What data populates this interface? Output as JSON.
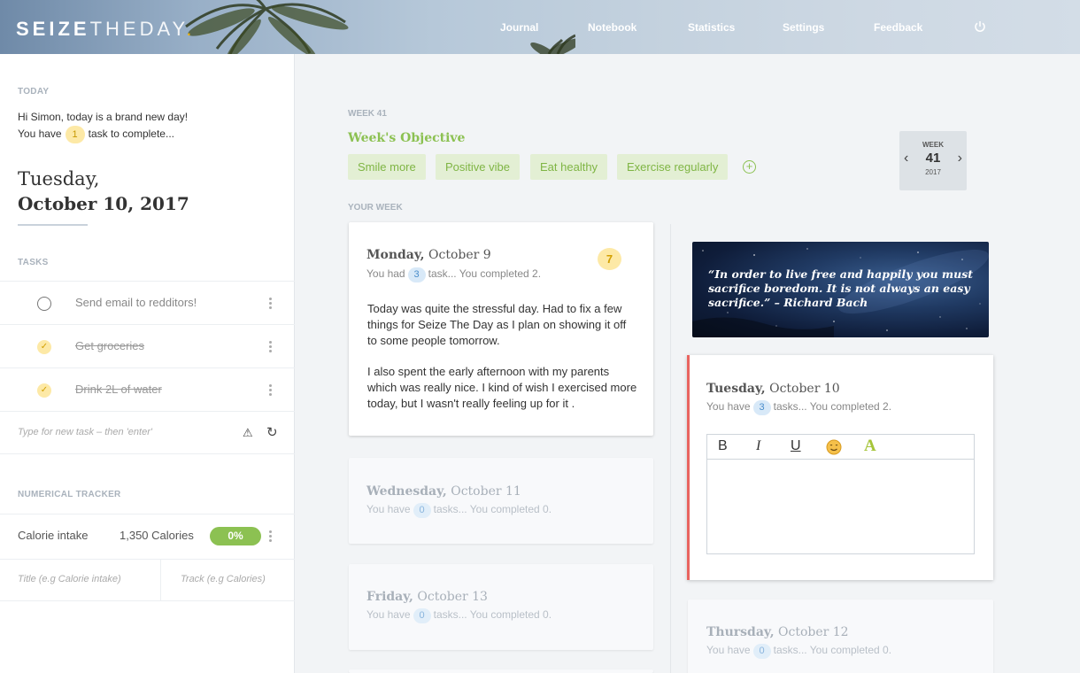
{
  "header": {
    "logo_part1": "SEIZE",
    "logo_part2": "THEDAY",
    "logo_dot": ".",
    "nav": [
      "Journal",
      "Notebook",
      "Statistics",
      "Settings",
      "Feedback"
    ]
  },
  "sidebar": {
    "today_label": "TODAY",
    "greeting": "Hi Simon, today is a brand new day!",
    "you_have": "You have",
    "task_count": "1",
    "task_suffix": "task to complete...",
    "date_line1": "Tuesday,",
    "date_line2": "October 10, 2017",
    "tasks_label": "TASKS",
    "tasks": [
      {
        "text": "Send email to redditors!",
        "done": false
      },
      {
        "text": "Get groceries",
        "done": true
      },
      {
        "text": "Drink 2L of water",
        "done": true
      }
    ],
    "new_task_placeholder": "Type for new task – then 'enter'",
    "tracker_label": "NUMERICAL TRACKER",
    "tracker": {
      "name": "Calorie intake",
      "value": "1,350 Calories",
      "percent": "0%"
    },
    "tracker_title_placeholder": "Title (e.g Calorie intake)",
    "tracker_track_placeholder": "Track (e.g Calories)"
  },
  "main": {
    "week_label": "WEEK 41",
    "objective_title": "Week's Objective",
    "objectives": [
      "Smile more",
      "Positive vibe",
      "Eat healthy",
      "Exercise regularly"
    ],
    "weekbox": {
      "label": "WEEK",
      "number": "41",
      "year": "2017"
    },
    "your_week_label": "YOUR WEEK",
    "monday": {
      "day": "Monday,",
      "date": "October 9",
      "pre": "You had",
      "count": "3",
      "post": "task... You completed 2.",
      "score": "7",
      "para1": "Today was quite the stressful day. Had to fix a few things for Seize The Day as I plan on showing it off to some people tomorrow.",
      "para2": "I also spent the early afternoon with my parents which was really nice. I kind of wish I exercised more today, but I wasn't really feeling up for it ."
    },
    "wednesday": {
      "day": "Wednesday,",
      "date": "October 11",
      "pre": "You have",
      "count": "0",
      "post": "tasks... You completed 0."
    },
    "friday": {
      "day": "Friday,",
      "date": "October 13",
      "pre": "You have",
      "count": "0",
      "post": "tasks... You completed 0."
    },
    "quote": "“In order to live free and happily you must sacrifice boredom. It is not always an easy sacrifice.” – Richard Bach",
    "tuesday": {
      "day": "Tuesday,",
      "date": "October 10",
      "pre": "You have",
      "count": "3",
      "post": "tasks... You completed 2."
    },
    "thursday": {
      "day": "Thursday,",
      "date": "October 12",
      "pre": "You have",
      "count": "0",
      "post": "tasks... You completed 0."
    },
    "toolbar": {
      "bold": "B",
      "italic": "I",
      "underline": "U",
      "color": "A"
    }
  },
  "colors": {
    "accent_green": "#8cc152",
    "active_border": "#e9645f",
    "badge_yellow": "#fde9a6",
    "badge_blue": "#d8e9f8"
  }
}
